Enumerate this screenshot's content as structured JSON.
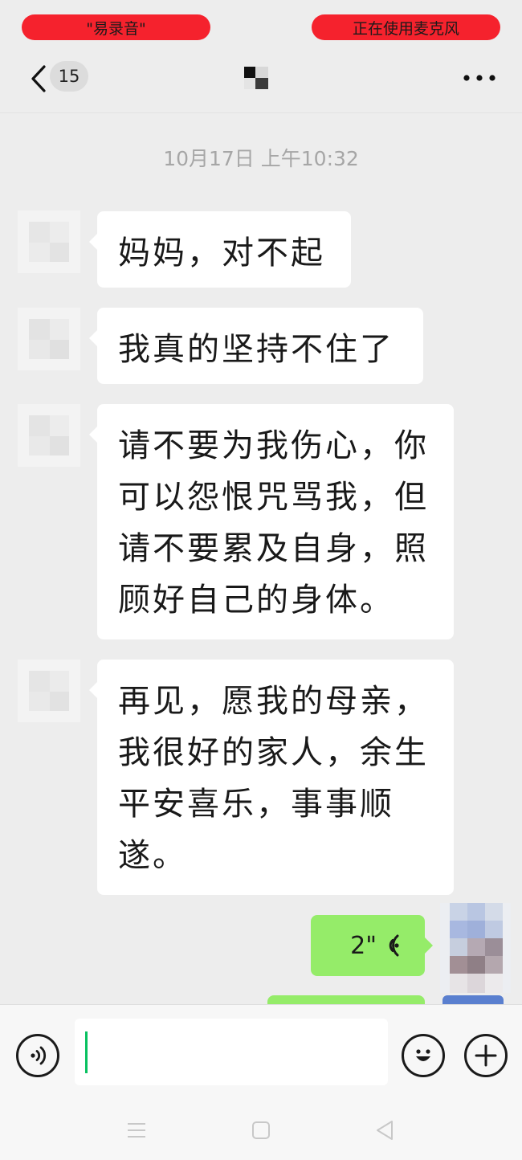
{
  "status": {
    "left_pill": "\"易录音\"",
    "right_pill": "正在使用麦克风",
    "pill_color": "#f5222d"
  },
  "header": {
    "back_icon": "chevron-left-icon",
    "unread_count": "15",
    "more_icon": "more-dots-icon"
  },
  "chat": {
    "timestamp": "10月17日  上午10:32",
    "messages": [
      {
        "lines": [
          "妈妈，对不起"
        ]
      },
      {
        "lines": [
          "我真的坚持不住了"
        ]
      },
      {
        "lines": [
          "请不要为我伤心，你",
          "可以怨恨咒骂我，但",
          "请不要累及自身，照",
          "顾好自己的身体。"
        ]
      },
      {
        "lines": [
          "再见，愿我的母亲，",
          "我很好的家人，余生",
          "平安喜乐，事事顺",
          "遂。"
        ]
      }
    ],
    "voice_message": {
      "duration": "2\"",
      "icon": "voice-wave-icon"
    }
  },
  "input_bar": {
    "voice_icon": "voice-input-icon",
    "emoji_icon": "emoji-icon",
    "plus_icon": "plus-icon",
    "text_value": ""
  },
  "colors": {
    "background": "#ededed",
    "bubble_incoming": "#ffffff",
    "bubble_outgoing": "#95ec69",
    "caret": "#07c160"
  }
}
